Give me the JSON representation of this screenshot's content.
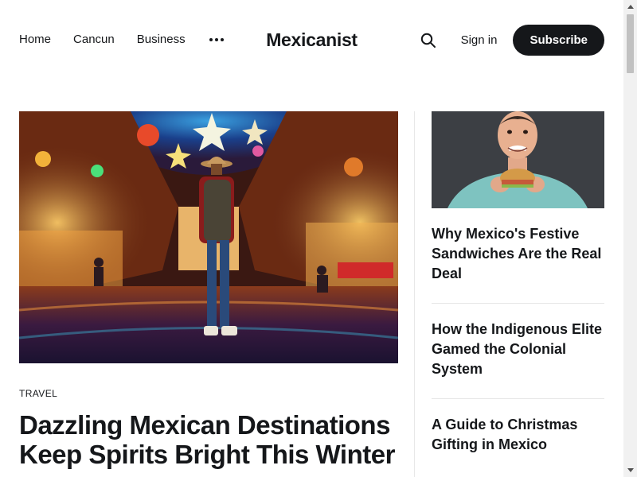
{
  "site": {
    "name": "Mexicanist"
  },
  "nav": {
    "items": [
      {
        "label": "Home"
      },
      {
        "label": "Cancun"
      },
      {
        "label": "Business"
      }
    ],
    "more_icon": "ellipsis-icon"
  },
  "actions": {
    "search_icon": "search-icon",
    "signin_label": "Sign in",
    "subscribe_label": "Subscribe"
  },
  "featured": {
    "tag": "TRAVEL",
    "title": "Dazzling Mexican Destinations Keep Spirits Bright This Winter"
  },
  "sidebar": {
    "items": [
      {
        "title": "Why Mexico's Festive Sandwiches Are the Real Deal"
      },
      {
        "title": "How the Indigenous Elite Gamed the Colonial System"
      },
      {
        "title": "A Guide to Christmas Gifting in Mexico"
      }
    ]
  },
  "colors": {
    "text": "#15171a",
    "subscribe_bg": "#15171a",
    "divider": "#e8e8e8"
  }
}
